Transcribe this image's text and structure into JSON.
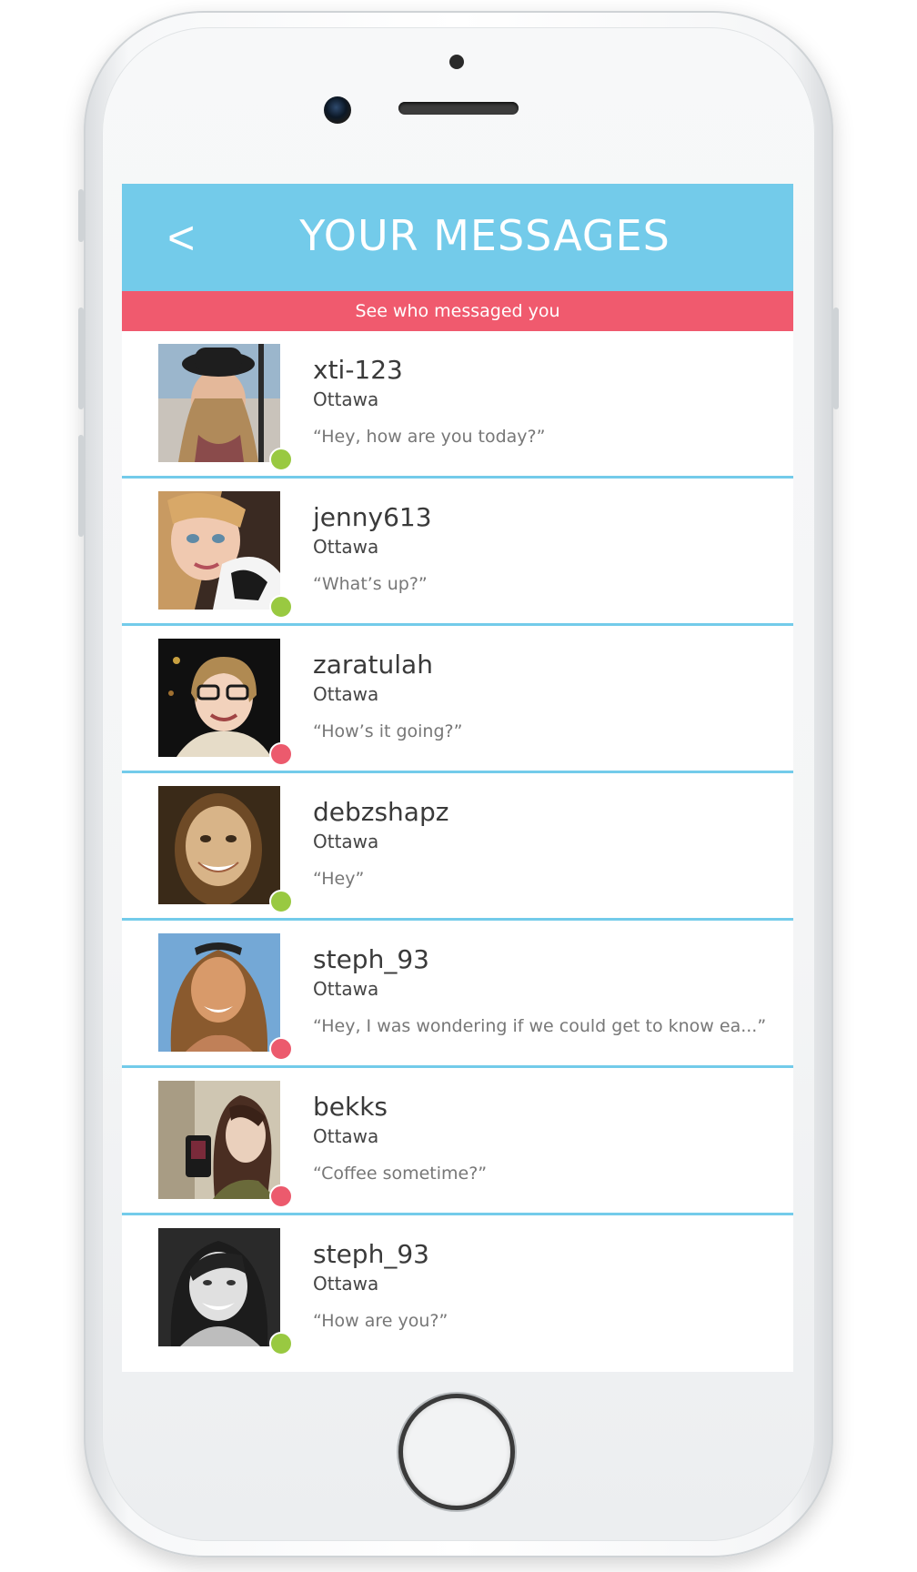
{
  "header": {
    "back_symbol": "<",
    "title": "YOUR MESSAGES",
    "subtitle": "See who messaged you"
  },
  "colors": {
    "header": "#73cbea",
    "subheader": "#f05a6e",
    "online": "#99c941",
    "away": "#ec5a6d"
  },
  "messages": [
    {
      "username": "xti-123",
      "city": "Ottawa",
      "preview": "“Hey, how are you today?”",
      "status": "online"
    },
    {
      "username": "jenny613",
      "city": "Ottawa",
      "preview": "“What’s up?”",
      "status": "online"
    },
    {
      "username": "zaratulah",
      "city": "Ottawa",
      "preview": "“How’s it going?”",
      "status": "away"
    },
    {
      "username": "debzshapz",
      "city": "Ottawa",
      "preview": "“Hey”",
      "status": "online"
    },
    {
      "username": "steph_93",
      "city": "Ottawa",
      "preview": "“Hey, I was wondering if we could get to know ea...”",
      "status": "away"
    },
    {
      "username": "bekks",
      "city": "Ottawa",
      "preview": "“Coffee sometime?”",
      "status": "away"
    },
    {
      "username": "steph_93",
      "city": "Ottawa",
      "preview": "“How are you?”",
      "status": "online"
    }
  ]
}
